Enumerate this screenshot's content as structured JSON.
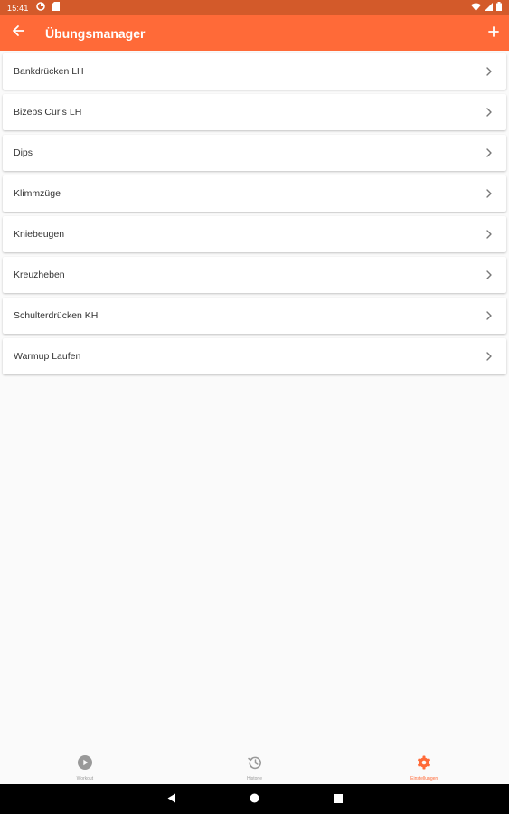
{
  "status_bar": {
    "time": "15:41"
  },
  "app_bar": {
    "title": "Übungsmanager"
  },
  "exercises": [
    {
      "label": "Bankdrücken LH"
    },
    {
      "label": "Bizeps Curls LH"
    },
    {
      "label": "Dips"
    },
    {
      "label": "Klimmzüge"
    },
    {
      "label": "Kniebeugen"
    },
    {
      "label": "Kreuzheben"
    },
    {
      "label": "Schulterdrücken KH"
    },
    {
      "label": "Warmup Laufen"
    }
  ],
  "bottom_nav": {
    "items": [
      {
        "label": "Workout",
        "icon": "play-icon",
        "active": false
      },
      {
        "label": "Historie",
        "icon": "history-icon",
        "active": false
      },
      {
        "label": "Einstellungen",
        "icon": "gear-icon",
        "active": true
      }
    ]
  },
  "colors": {
    "primary": "#ff6a38",
    "status_bar": "#d35a2a",
    "background": "#fafafa",
    "inactive_nav": "#999999"
  }
}
